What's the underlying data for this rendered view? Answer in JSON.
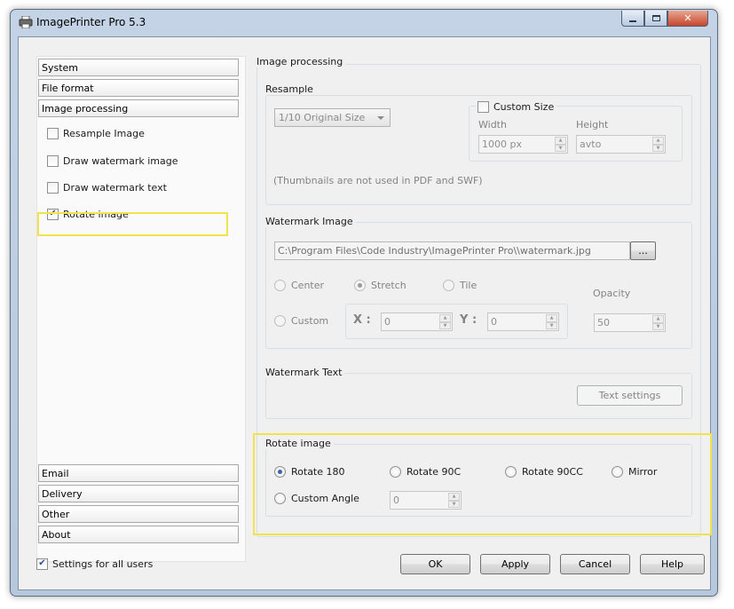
{
  "window": {
    "title": "ImagePrinter Pro 5.3"
  },
  "sidebar": {
    "top_items": [
      {
        "label": "System"
      },
      {
        "label": "File format"
      },
      {
        "label": "Image processing"
      }
    ],
    "sub_items": [
      {
        "label": "Resample Image",
        "checked": false
      },
      {
        "label": "Draw watermark image",
        "checked": false
      },
      {
        "label": "Draw watermark text",
        "checked": false
      },
      {
        "label": "Rotate image",
        "checked": true
      }
    ],
    "bottom_items": [
      {
        "label": "Email"
      },
      {
        "label": "Delivery"
      },
      {
        "label": "Other"
      },
      {
        "label": "About"
      }
    ]
  },
  "settings_for_all_users": {
    "label": "Settings for all users",
    "checked": true
  },
  "main": {
    "title": "Image processing",
    "resample": {
      "title": "Resample",
      "size_select": "1/10 Original Size",
      "custom_size_label": "Custom Size",
      "width_label": "Width",
      "height_label": "Height",
      "width_value": "1000 px",
      "height_value": "avto",
      "note": "(Thumbnails are not used in PDF and SWF)"
    },
    "watermark_image": {
      "title": "Watermark Image",
      "path": "C:\\Program Files\\Code Industry\\ImagePrinter Pro\\\\watermark.jpg",
      "browse_label": "...",
      "center_label": "Center",
      "stretch_label": "Stretch",
      "tile_label": "Tile",
      "custom_label": "Custom",
      "opacity_label": "Opacity",
      "x_label": "X :",
      "y_label": "Y :",
      "x_value": "0",
      "y_value": "0",
      "opacity_value": "50"
    },
    "watermark_text": {
      "title": "Watermark Text",
      "settings_label": "Text settings"
    },
    "rotate": {
      "title": "Rotate image",
      "rotate180_label": "Rotate 180",
      "rotate90c_label": "Rotate 90C",
      "rotate90cc_label": "Rotate 90CC",
      "mirror_label": "Mirror",
      "custom_angle_label": "Custom Angle",
      "angle_value": "0"
    }
  },
  "footer": {
    "ok_label": "OK",
    "apply_label": "Apply",
    "cancel_label": "Cancel",
    "help_label": "Help"
  },
  "colors": {
    "highlight": "#f3e34a",
    "accent": "#3b64a4"
  }
}
